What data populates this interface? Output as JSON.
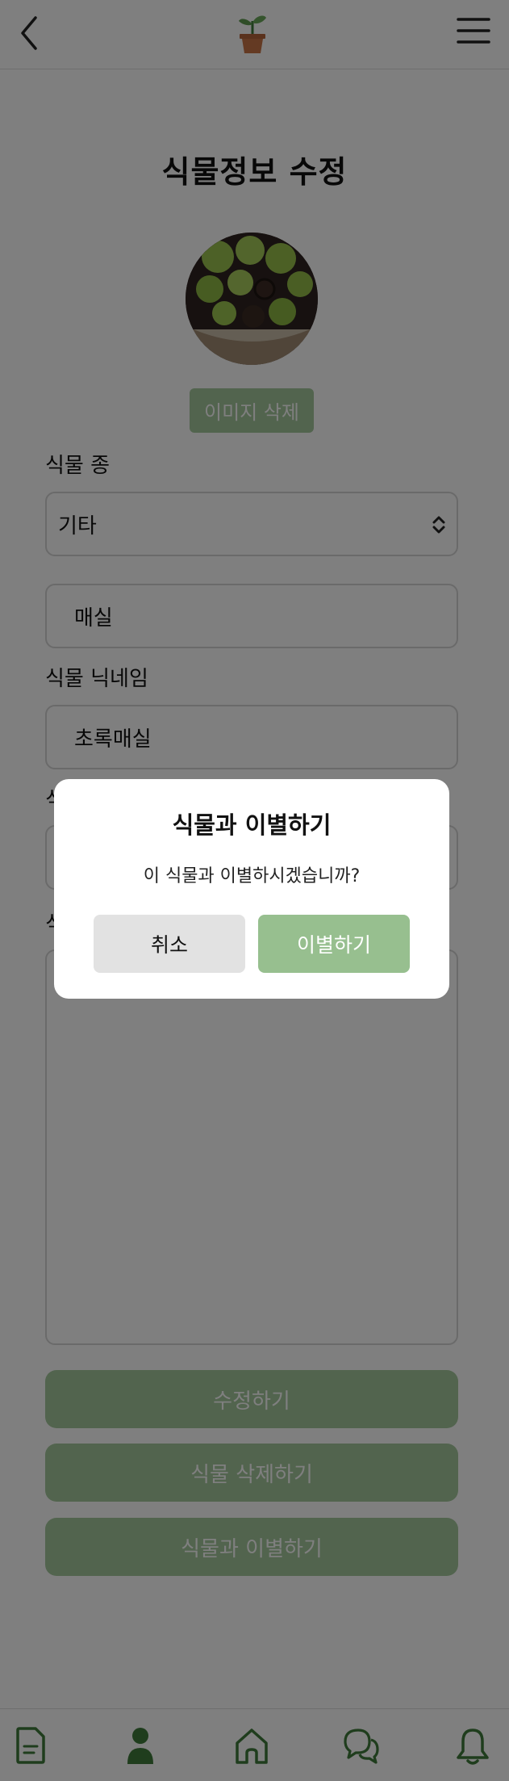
{
  "page": {
    "title": "식물정보 수정",
    "image_delete_label": "이미지 삭제"
  },
  "form": {
    "species_label": "식물 종",
    "species_value": "기타",
    "species_name_value": "매실",
    "nickname_label": "식물 닉네임",
    "nickname_value": "초록매실",
    "hidden_label_1": "식",
    "hidden_label_2": "식"
  },
  "actions": {
    "edit_label": "수정하기",
    "delete_label": "식물 삭제하기",
    "farewell_label": "식물과 이별하기"
  },
  "modal": {
    "title": "식물과 이별하기",
    "message": "이 식물과 이별하시겠습니까?",
    "cancel_label": "취소",
    "confirm_label": "이별하기"
  },
  "tabbar": {
    "items": [
      "document-icon",
      "person-icon",
      "home-icon",
      "chat-icon",
      "bell-icon"
    ]
  },
  "colors": {
    "accent_green": "#97bf8f",
    "button_green": "#a4c89c",
    "icon_green": "#3f7a3a",
    "overlay": "rgba(0,0,0,0.5)"
  }
}
